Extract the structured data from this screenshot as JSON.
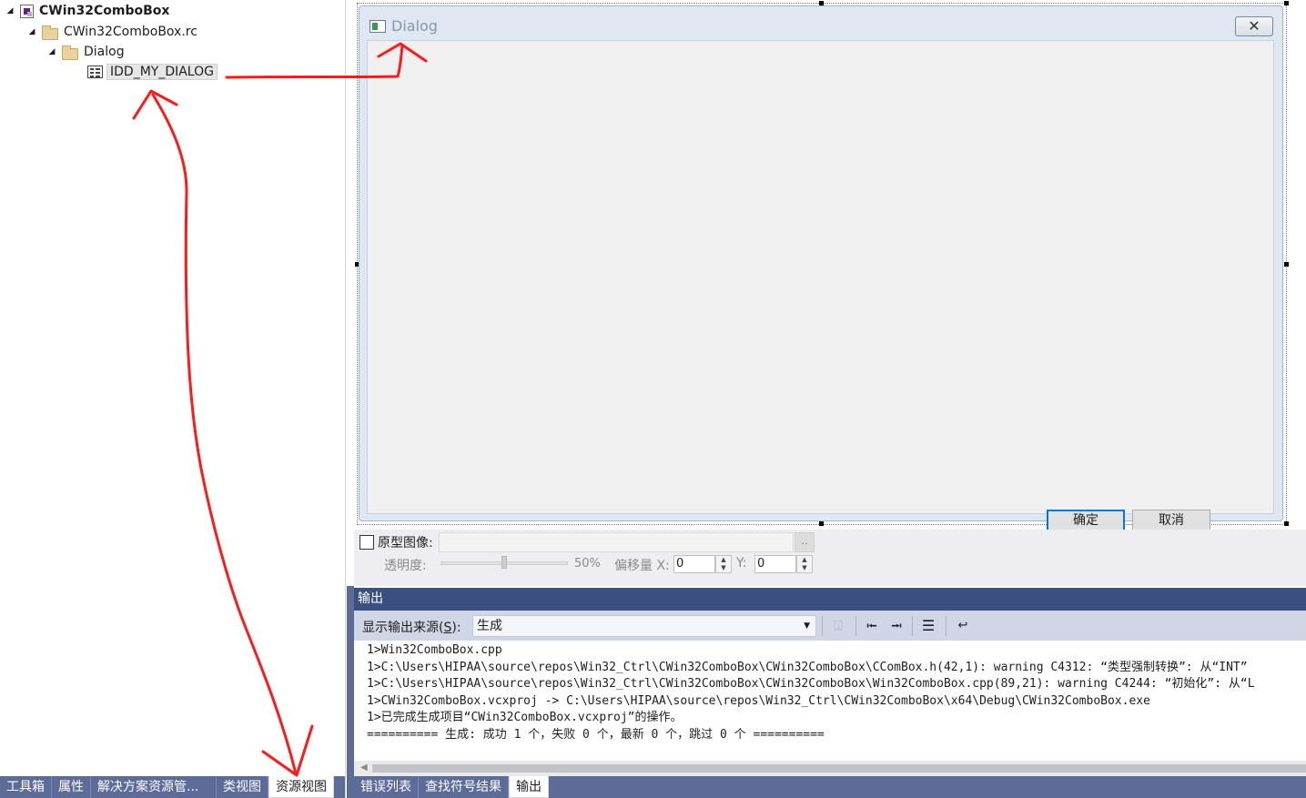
{
  "tree": {
    "project": "CWin32ComboBox",
    "rc_file": "CWin32ComboBox.rc",
    "folder": "Dialog",
    "dialog_id": "IDD_MY_DIALOG"
  },
  "left_tabs": [
    "工具箱",
    "属性",
    "解决方案资源管...",
    "类视图",
    "资源视图"
  ],
  "left_active_tab": "资源视图",
  "dialog": {
    "title": "Dialog",
    "close_glyph": "✕",
    "ok_label": "确定",
    "cancel_label": "取消"
  },
  "prototype": {
    "label": "原型图像:",
    "browse_label": "..",
    "opacity_label": "透明度:",
    "opacity_value": "50%",
    "opacity_fraction": 0.5,
    "offset_label": "偏移量 X:",
    "offset_x": "0",
    "y_label": "Y:",
    "offset_y": "0"
  },
  "output": {
    "header": "输出",
    "source_label_prefix": "显示输出来源(",
    "source_label_key": "S",
    "source_label_suffix": "):",
    "source_value": "生成",
    "lines": [
      "1>Win32ComboBox.cpp",
      "1>C:\\Users\\HIPAA\\source\\repos\\Win32_Ctrl\\CWin32ComboBox\\CWin32ComboBox\\CComBox.h(42,1): warning C4312: “类型强制转换”: 从“INT”",
      "1>C:\\Users\\HIPAA\\source\\repos\\Win32_Ctrl\\CWin32ComboBox\\CWin32ComboBox\\Win32ComboBox.cpp(89,21): warning C4244: “初始化”: 从“L",
      "1>CWin32ComboBox.vcxproj -> C:\\Users\\HIPAA\\source\\repos\\Win32_Ctrl\\CWin32ComboBox\\x64\\Debug\\CWin32ComboBox.exe",
      "1>已完成生成项目“CWin32ComboBox.vcxproj”的操作。",
      "========== 生成: 成功 1 个，失败 0 个，最新 0 个，跳过 0 个 =========="
    ]
  },
  "right_tabs": [
    "错误列表",
    "查找符号结果",
    "输出"
  ],
  "right_active_tab": "输出",
  "icons": {
    "toolbar": [
      "find-message-icon",
      "prev-message-icon",
      "next-message-icon",
      "clear-all-icon",
      "word-wrap-icon"
    ]
  },
  "colors": {
    "tab_bar": "#5d6b99",
    "output_header": "#3b4f81",
    "toolbar": "#cfd6e5",
    "annotation": "#ff1a1a",
    "ok_focus": "#0078d7"
  }
}
